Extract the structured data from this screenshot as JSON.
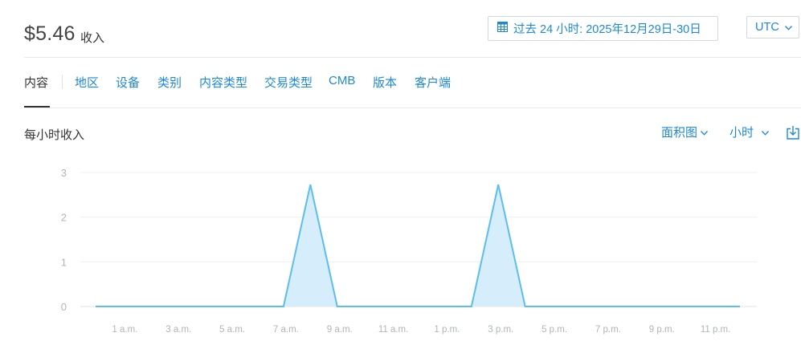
{
  "summary": {
    "amount": "$5.46",
    "label": "收入"
  },
  "date_range": {
    "label": "过去 24 小时: 2025年12月29日-30日",
    "icon": "calendar-icon"
  },
  "timezone": {
    "label": "UTC"
  },
  "tabs": [
    {
      "label": "内容",
      "active": true
    },
    {
      "label": "地区"
    },
    {
      "label": "设备"
    },
    {
      "label": "类别"
    },
    {
      "label": "内容类型"
    },
    {
      "label": "交易类型"
    },
    {
      "label": "CMB"
    },
    {
      "label": "版本"
    },
    {
      "label": "客户端"
    }
  ],
  "chart_section": {
    "title": "每小时收入",
    "chart_type_label": "面积图",
    "granularity_label": "小时",
    "download_icon": "download-icon"
  },
  "colors": {
    "accent": "#1e88d6",
    "line": "#5bbdf0",
    "fill": "#d6eefb"
  },
  "chart_data": {
    "type": "area",
    "xlabel": "",
    "ylabel": "",
    "ylim": [
      0,
      3
    ],
    "yticks": [
      "0",
      "1",
      "2",
      "3"
    ],
    "xtick_labels": [
      "1 a.m.",
      "3 a.m.",
      "5 a.m.",
      "7 a.m.",
      "9 a.m.",
      "11 a.m.",
      "1 p.m.",
      "3 p.m.",
      "5 p.m.",
      "7 p.m.",
      "9 p.m.",
      "11 p.m."
    ],
    "grid": true,
    "x": [
      "0 a.m.",
      "1 a.m.",
      "2 a.m.",
      "3 a.m.",
      "4 a.m.",
      "5 a.m.",
      "6 a.m.",
      "7 a.m.",
      "8 a.m.",
      "9 a.m.",
      "10 a.m.",
      "11 a.m.",
      "12 p.m.",
      "1 p.m.",
      "2 p.m.",
      "3 p.m.",
      "4 p.m.",
      "5 p.m.",
      "6 p.m.",
      "7 p.m.",
      "8 p.m.",
      "9 p.m.",
      "10 p.m.",
      "11 p.m.",
      "12 a.m."
    ],
    "series": [
      {
        "values": [
          0,
          0,
          0,
          0,
          0,
          0,
          0,
          0,
          2.73,
          0,
          0,
          0,
          0,
          0,
          0,
          2.73,
          0,
          0,
          0,
          0,
          0,
          0,
          0,
          0,
          0
        ]
      }
    ]
  }
}
